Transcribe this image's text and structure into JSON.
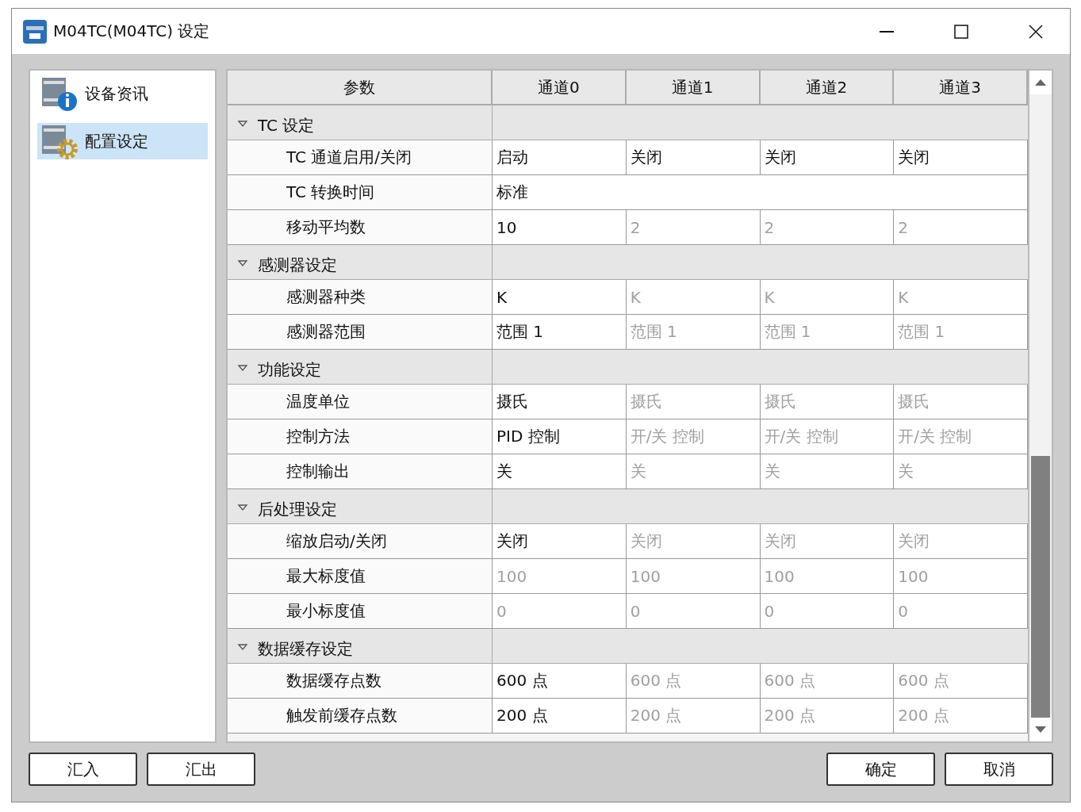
{
  "window": {
    "title": "M04TC(M04TC) 设定"
  },
  "sidebar": {
    "items": [
      {
        "label": "设备资讯",
        "kind": "info",
        "selected": false
      },
      {
        "label": "配置设定",
        "kind": "config",
        "selected": true
      }
    ]
  },
  "table": {
    "columns": [
      "参数",
      "通道0",
      "通道1",
      "通道2",
      "通道3"
    ],
    "groups": [
      {
        "label": "TC 设定",
        "expanded": true,
        "rows": [
          {
            "label": "TC 通道启用/关闭",
            "cells": [
              {
                "text": "启动",
                "disabled": false
              },
              {
                "text": "关闭",
                "disabled": false
              },
              {
                "text": "关闭",
                "disabled": false
              },
              {
                "text": "关闭",
                "disabled": false
              }
            ]
          },
          {
            "label": "TC 转换时间",
            "cells": [
              {
                "text": "标准",
                "disabled": false
              }
            ]
          },
          {
            "label": "移动平均数",
            "cells": [
              {
                "text": "10",
                "disabled": false
              },
              {
                "text": "2",
                "disabled": true
              },
              {
                "text": "2",
                "disabled": true
              },
              {
                "text": "2",
                "disabled": true
              }
            ]
          }
        ]
      },
      {
        "label": "感测器设定",
        "expanded": true,
        "rows": [
          {
            "label": "感测器种类",
            "cells": [
              {
                "text": "K",
                "disabled": false
              },
              {
                "text": "K",
                "disabled": true
              },
              {
                "text": "K",
                "disabled": true
              },
              {
                "text": "K",
                "disabled": true
              }
            ]
          },
          {
            "label": "感测器范围",
            "cells": [
              {
                "text": "范围 1",
                "disabled": false
              },
              {
                "text": "范围 1",
                "disabled": true
              },
              {
                "text": "范围 1",
                "disabled": true
              },
              {
                "text": "范围 1",
                "disabled": true
              }
            ]
          }
        ]
      },
      {
        "label": "功能设定",
        "expanded": true,
        "rows": [
          {
            "label": "温度单位",
            "cells": [
              {
                "text": "摄氏",
                "disabled": false
              },
              {
                "text": "摄氏",
                "disabled": true
              },
              {
                "text": "摄氏",
                "disabled": true
              },
              {
                "text": "摄氏",
                "disabled": true
              }
            ]
          },
          {
            "label": "控制方法",
            "cells": [
              {
                "text": "PID 控制",
                "disabled": false
              },
              {
                "text": "开/关 控制",
                "disabled": true
              },
              {
                "text": "开/关 控制",
                "disabled": true
              },
              {
                "text": "开/关 控制",
                "disabled": true
              }
            ]
          },
          {
            "label": "控制输出",
            "cells": [
              {
                "text": "关",
                "disabled": false
              },
              {
                "text": "关",
                "disabled": true
              },
              {
                "text": "关",
                "disabled": true
              },
              {
                "text": "关",
                "disabled": true
              }
            ]
          }
        ]
      },
      {
        "label": "后处理设定",
        "expanded": true,
        "rows": [
          {
            "label": "缩放启动/关闭",
            "cells": [
              {
                "text": "关闭",
                "disabled": false
              },
              {
                "text": "关闭",
                "disabled": true
              },
              {
                "text": "关闭",
                "disabled": true
              },
              {
                "text": "关闭",
                "disabled": true
              }
            ]
          },
          {
            "label": "最大标度值",
            "cells": [
              {
                "text": "100",
                "disabled": true
              },
              {
                "text": "100",
                "disabled": true
              },
              {
                "text": "100",
                "disabled": true
              },
              {
                "text": "100",
                "disabled": true
              }
            ]
          },
          {
            "label": "最小标度值",
            "cells": [
              {
                "text": "0",
                "disabled": true
              },
              {
                "text": "0",
                "disabled": true
              },
              {
                "text": "0",
                "disabled": true
              },
              {
                "text": "0",
                "disabled": true
              }
            ]
          }
        ]
      },
      {
        "label": "数据缓存设定",
        "expanded": true,
        "rows": [
          {
            "label": "数据缓存点数",
            "cells": [
              {
                "text": "600 点",
                "disabled": false
              },
              {
                "text": "600 点",
                "disabled": true
              },
              {
                "text": "600 点",
                "disabled": true
              },
              {
                "text": "600 点",
                "disabled": true
              }
            ]
          },
          {
            "label": "触发前缓存点数",
            "cells": [
              {
                "text": "200 点",
                "disabled": false
              },
              {
                "text": "200 点",
                "disabled": true
              },
              {
                "text": "200 点",
                "disabled": true
              },
              {
                "text": "200 点",
                "disabled": true
              }
            ]
          }
        ]
      }
    ]
  },
  "left_buttons": [
    "汇入",
    "汇出"
  ],
  "right_buttons": [
    "确定",
    "取消"
  ]
}
